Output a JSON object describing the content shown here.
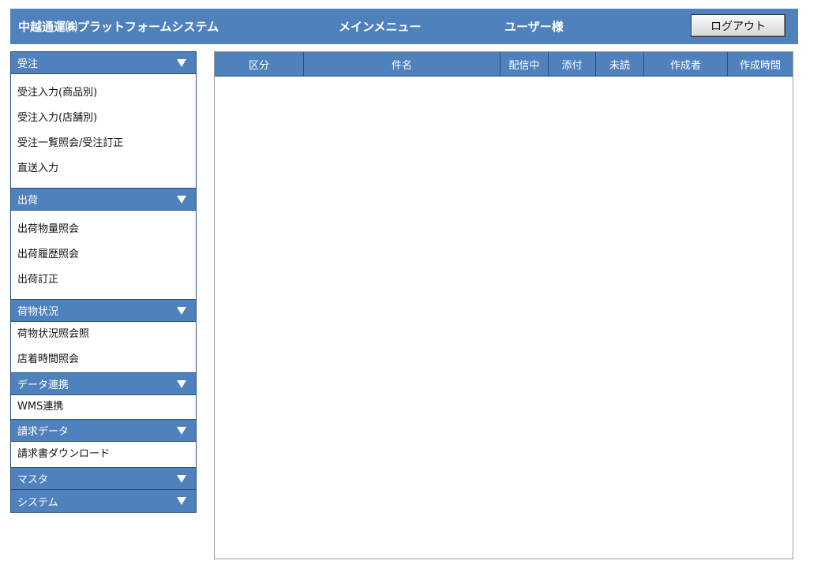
{
  "header": {
    "app_title": "中越通運㈱プラットフォームシステム",
    "menu_title": "メインメニュー",
    "user_name": "ユーザー様",
    "logout_label": "ログアウト"
  },
  "sidebar": {
    "sections": [
      {
        "title": "受注",
        "items": [
          "受注入力(商品別)",
          "受注入力(店舗別)",
          "受注一覧照会/受注訂正",
          "直送入力"
        ]
      },
      {
        "title": "出荷",
        "items": [
          "出荷物量照会",
          "出荷履歴照会",
          "出荷訂正"
        ]
      },
      {
        "title": "荷物状況",
        "items": [
          "荷物状況照会照",
          "店着時間照会"
        ]
      },
      {
        "title": "データ連携",
        "items": [
          "WMS連携"
        ]
      },
      {
        "title": "請求データ",
        "items": [
          "請求書ダウンロード"
        ]
      },
      {
        "title": "マスタ",
        "items": []
      },
      {
        "title": "システム",
        "items": []
      }
    ]
  },
  "table": {
    "columns": [
      "区分",
      "件名",
      "配信中",
      "添付",
      "未読",
      "作成者",
      "作成時間"
    ],
    "rows": []
  },
  "colors": {
    "accent": "#4f81bd",
    "accent_border": "#2a4e7e"
  }
}
